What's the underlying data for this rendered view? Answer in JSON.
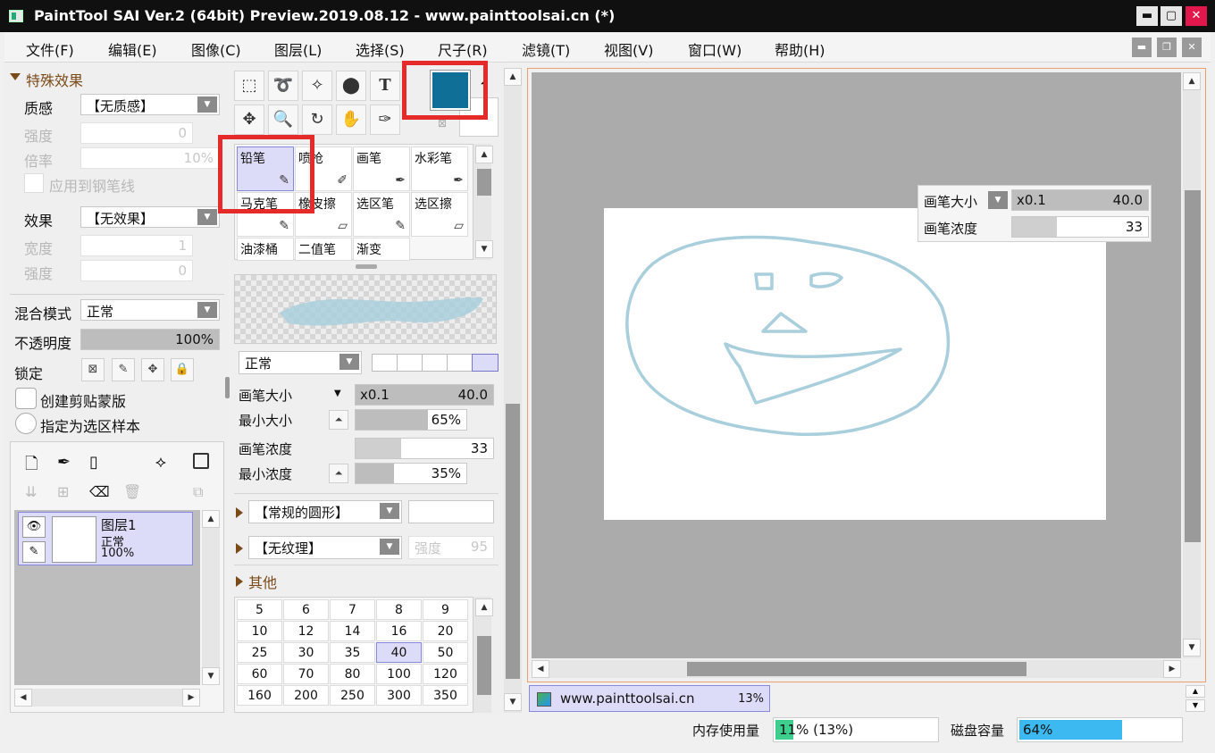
{
  "window": {
    "title": "PaintTool SAI Ver.2 (64bit) Preview.2019.08.12 - www.painttoolsai.cn (*)",
    "min_label": "▬",
    "max_label": "▢",
    "close_label": "✕"
  },
  "menu": {
    "items": [
      "文件(F)",
      "编辑(E)",
      "图像(C)",
      "图层(L)",
      "选择(S)",
      "尺子(R)",
      "滤镜(T)",
      "视图(V)",
      "窗口(W)",
      "帮助(H)"
    ],
    "min_label": "▬",
    "restore_label": "❐",
    "close_label": "✕"
  },
  "effects": {
    "header": "特殊效果",
    "texture_label": "质感",
    "texture_value": "【无质感】",
    "strength_label": "强度",
    "strength_value": "0",
    "scale_label": "倍率",
    "scale_value": "10%",
    "apply_pen_label": "应用到钢笔线",
    "effect_label": "效果",
    "effect_value": "【无效果】",
    "width_label": "宽度",
    "width_value": "1",
    "strength2_label": "强度",
    "strength2_value": "0"
  },
  "layer_props": {
    "blend_label": "混合模式",
    "blend_value": "正常",
    "opacity_label": "不透明度",
    "opacity_value": "100%",
    "opacity_fraction": 1.0,
    "lock_label": "锁定",
    "clip_label": "创建剪贴蒙版",
    "sample_label": "指定为选区样本"
  },
  "layers": [
    {
      "name": "图层1",
      "mode": "正常",
      "opacity": "100%"
    }
  ],
  "tools": {
    "text_tool": "T"
  },
  "brushes": [
    {
      "label": "铅笔",
      "selected": true,
      "icon": "pencil-icon",
      "glyph": "✎"
    },
    {
      "label": "喷枪",
      "selected": false,
      "icon": "airbrush-icon",
      "glyph": "✐"
    },
    {
      "label": "画笔",
      "selected": false,
      "icon": "brush-icon",
      "glyph": "✒"
    },
    {
      "label": "水彩笔",
      "selected": false,
      "icon": "watercolor-icon",
      "glyph": "✒"
    },
    {
      "label": "马克笔",
      "selected": false,
      "icon": "marker-icon",
      "glyph": "✎"
    },
    {
      "label": "橡皮擦",
      "selected": false,
      "icon": "eraser-icon",
      "glyph": "▱"
    },
    {
      "label": "选区笔",
      "selected": false,
      "icon": "selpen-icon",
      "glyph": "✎"
    },
    {
      "label": "选区擦",
      "selected": false,
      "icon": "selerase-icon",
      "glyph": "▱"
    },
    {
      "label": "油漆桶",
      "selected": false,
      "icon": "",
      "glyph": ""
    },
    {
      "label": "二值笔",
      "selected": false,
      "icon": "",
      "glyph": ""
    },
    {
      "label": "渐变",
      "selected": false,
      "icon": "",
      "glyph": ""
    }
  ],
  "brush_settings": {
    "mode_value": "正常",
    "size_label": "画笔大小",
    "size_multiplier": "x0.1",
    "size_value": "40.0",
    "min_size_label": "最小大小",
    "min_size_value": "65%",
    "min_size_fraction": 0.65,
    "density_label": "画笔浓度",
    "density_value": "33",
    "density_fraction": 0.33,
    "min_density_label": "最小浓度",
    "min_density_value": "35%",
    "min_density_fraction": 0.35,
    "shape_value": "【常规的圆形】",
    "texture_value": "【无纹理】",
    "texture_strength_label": "强度",
    "texture_strength_value": "95",
    "other_label": "其他"
  },
  "size_presets": [
    "5",
    "6",
    "7",
    "8",
    "9",
    "10",
    "12",
    "14",
    "16",
    "20",
    "25",
    "30",
    "35",
    "40",
    "50",
    "60",
    "70",
    "80",
    "100",
    "120",
    "160",
    "200",
    "250",
    "300",
    "350"
  ],
  "size_selected": "40",
  "canvas_overlay": {
    "size_label": "画笔大小",
    "size_multiplier": "x0.1",
    "size_value": "40.0",
    "density_label": "画笔浓度",
    "density_value": "33"
  },
  "colors": {
    "primary": "#0f6f97",
    "stroke": "#a9cfdc",
    "highlight_box": "#e52a2a",
    "memory_bar": "#3ecf8e",
    "disk_bar": "#3cb9f0"
  },
  "document_tab": {
    "name": "www.painttoolsai.cn",
    "zoom": "13%"
  },
  "status": {
    "memory_label": "内存使用量",
    "memory_value": "11% (13%)",
    "memory_fraction": 0.11,
    "disk_label": "磁盘容量",
    "disk_value": "64%",
    "disk_fraction": 0.64
  }
}
